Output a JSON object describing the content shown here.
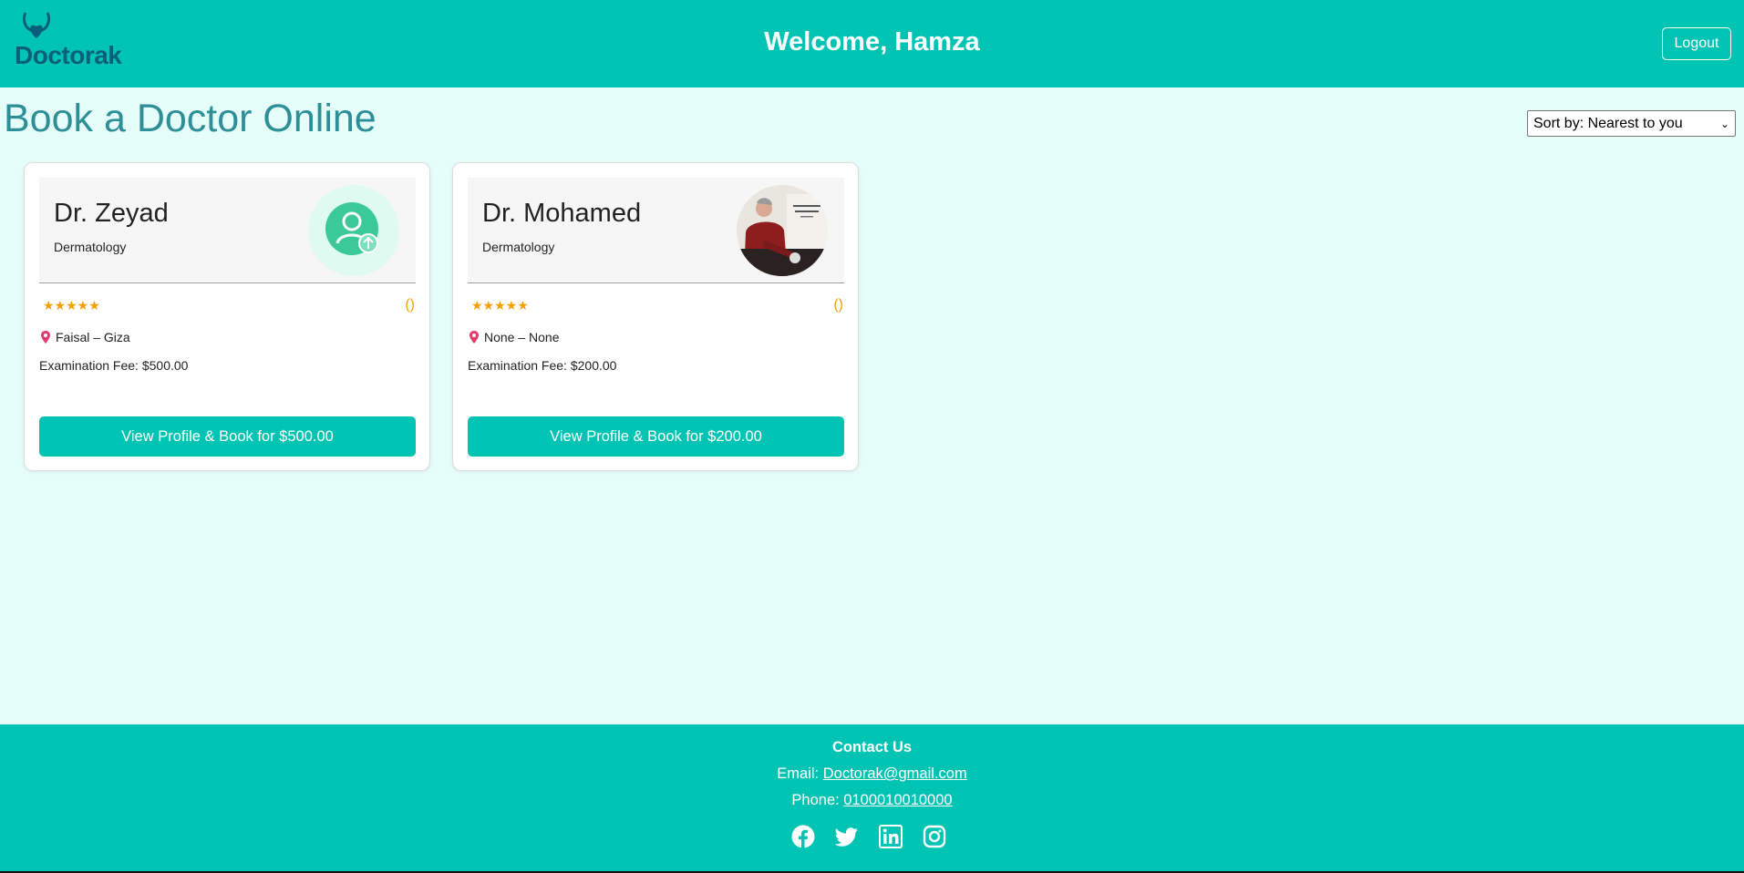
{
  "header": {
    "logo_text": "Doctorak",
    "welcome": "Welcome, Hamza",
    "logout_label": "Logout"
  },
  "main": {
    "title": "Book a Doctor Online",
    "sort_selected": "Sort by: Nearest to you"
  },
  "doctors": [
    {
      "name": "Dr. Zeyad",
      "specialty": "Dermatology",
      "stars": "★★★★★",
      "rating_count": "()",
      "location": "Faisal – Giza",
      "fee": "Examination Fee: $500.00",
      "book_label": "View Profile & Book for $500.00",
      "avatar": "default-user-icon"
    },
    {
      "name": "Dr. Mohamed",
      "specialty": "Dermatology",
      "stars": "★★★★★",
      "rating_count": "()",
      "location": "None – None",
      "fee": "Examination Fee: $200.00",
      "book_label": "View Profile & Book for $200.00",
      "avatar": "doctor-photo"
    }
  ],
  "footer": {
    "title": "Contact Us",
    "email_label": "Email: ",
    "email": "Doctorak@gmail.com",
    "phone_label": "Phone: ",
    "phone": "0100010010000",
    "socials": [
      "facebook-icon",
      "twitter-icon",
      "linkedin-icon",
      "instagram-icon"
    ]
  },
  "colors": {
    "primary": "#00c4b3",
    "background": "#e6fefa",
    "title": "#2e8f99",
    "star": "#f5a000",
    "logo": "#0b5f7a"
  }
}
